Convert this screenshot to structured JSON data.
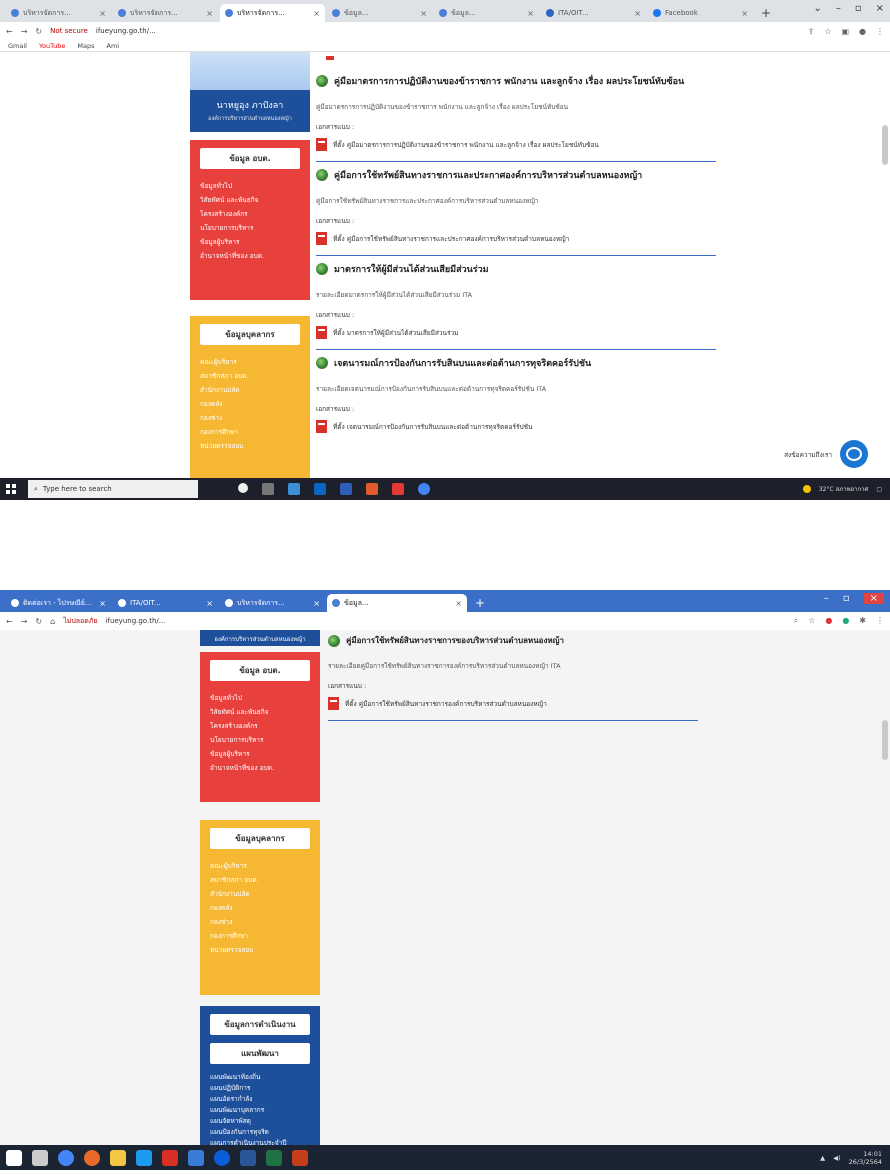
{
  "shot1": {
    "tabs": [
      {
        "label": "บริหารจัดการ..."
      },
      {
        "label": "บริหารจัดการ..."
      },
      {
        "label": "บริหารจัดการ..."
      },
      {
        "label": "ข้อมูล..."
      },
      {
        "label": "ข้อมูล..."
      },
      {
        "label": "ITA/OIT..."
      },
      {
        "label": "Facebook"
      }
    ],
    "url_warning": "Not secure",
    "url": "ifueyung.go.th/...",
    "bookmarks": [
      "Gmail",
      "YouTube",
      "Maps",
      "Ami"
    ],
    "brand_name": "นาหยูอุง ภาปังลา",
    "brand_sub": "องค์การบริหารส่วนตำบลหนองหญ้า",
    "sidebar_red_title": "ข้อมูล อบต.",
    "sidebar_red_links": [
      "ข้อมูลทั่วไป",
      "วิสัยทัศน์ และพันธกิจ",
      "โครงสร้างองค์กร",
      "นโยบายการบริหาร",
      "ข้อมูลผู้บริหาร",
      "อำนาจหน้าที่ของ อบต."
    ],
    "sidebar_yellow_title": "ข้อมูลบุคลากร",
    "sidebar_yellow_links": [
      "คณะผู้บริหาร",
      "สมาชิกสภา อบต.",
      "สำนักงานปลัด",
      "กองคลัง",
      "กองช่าง",
      "กองการศึกษา",
      "หน่วยตรวจสอบ"
    ],
    "sections": [
      {
        "title": "คู่มือมาตรการการปฏิบัติงานของข้าราชการ พนักงาน และลูกจ้าง เรื่อง ผลประโยชน์ทับซ้อน",
        "desc": "คู่มือมาตรการการปฏิบัติงานของข้าราชการ พนักงาน และลูกจ้าง เรื่อง ผลประโยชน์ทับซ้อน",
        "attach_label": "เอกสารแนบ :",
        "file": "ที่ตั้ง คู่มือมาตรการการปฏิบัติงานของข้าราชการ พนักงาน และลูกจ้าง เรื่อง ผลประโยชน์ทับซ้อน"
      },
      {
        "title": "คู่มือการใช้ทรัพย์สินทางราชการและประกาศองค์การบริหารส่วนตำบลหนองหญ้า",
        "desc": "คู่มือการใช้ทรัพย์สินทางราชการและประกาศองค์การบริหารส่วนตำบลหนองหญ้า",
        "attach_label": "เอกสารแนบ :",
        "file": "ที่ตั้ง คู่มือการใช้ทรัพย์สินทางราชการและประกาศองค์การบริหารส่วนตำบลหนองหญ้า"
      },
      {
        "title": "มาตรการให้ผู้มีส่วนได้ส่วนเสียมีส่วนร่วม",
        "desc": "รายละเอียดมาตรการให้ผู้มีส่วนได้ส่วนเสียมีส่วนร่วม ITA",
        "attach_label": "เอกสารแนบ :",
        "file": "ที่ตั้ง มาตรการให้ผู้มีส่วนได้ส่วนเสียมีส่วนร่วม"
      },
      {
        "title": "เจตนารมณ์การป้องกันการรับสินบนและต่อต้านการทุจริตคอร์รัปชัน",
        "desc": "รายละเอียดเจตนารมณ์การป้องกันการรับสินบนและต่อต้านการทุจริตคอร์รัปชัน ITA",
        "attach_label": "เอกสารแนบ :",
        "file": "ที่ตั้ง เจตนารมณ์การป้องกันการรับสินบนและต่อต้านการทุจริตคอร์รัปชัน"
      }
    ],
    "chat_label": "ส่งข้อความถึงเรา",
    "search_placeholder": "Type here to search",
    "tray_text": "32°C สภาพอากาศ"
  },
  "shot2": {
    "tabs": [
      {
        "label": "ติดต่อเรา - ไปรษณีย์..."
      },
      {
        "label": "ITA/OIT..."
      },
      {
        "label": "บริหารจัดการ..."
      },
      {
        "label": "ข้อมูล..."
      }
    ],
    "url_warning": "ไม่ปลอดภัย",
    "url": "ifueyung.go.th/...",
    "section": {
      "title": "คู่มือการใช้ทรัพย์สินทางราชการของบริหารส่วนตำบลหนองหญ้า",
      "desc": "รายละเอียดคู่มือการใช้ทรัพย์สินทางราชการองค์การบริหารส่วนตำบลหนองหญ้า ITA",
      "attach_label": "เอกสารแนบ :",
      "file": "ที่ตั้ง คู่มือการใช้ทรัพย์สินทางราชการองค์การบริหารส่วนตำบลหนองหญ้า"
    },
    "sidebar_top_label": "องค์การบริหารส่วนตำบลหนองหญ้า",
    "sidebar_red_title": "ข้อมูล อบต.",
    "sidebar_red_links": [
      "ข้อมูลทั่วไป",
      "วิสัยทัศน์ และพันธกิจ",
      "โครงสร้างองค์กร",
      "นโยบายการบริหาร",
      "ข้อมูลผู้บริหาร",
      "อำนาจหน้าที่ของ อบต."
    ],
    "sidebar_yellow_title": "ข้อมูลบุคลากร",
    "sidebar_yellow_links": [
      "คณะผู้บริหาร",
      "สมาชิกสภา อบต.",
      "สำนักงานปลัด",
      "กองคลัง",
      "กองช่าง",
      "กองการศึกษา",
      "หน่วยตรวจสอบ"
    ],
    "sidebar_blue_title1": "ข้อมูลการดำเนินงาน",
    "sidebar_blue_title2": "แผนพัฒนา",
    "sidebar_blue_links": [
      "แผนพัฒนาท้องถิ่น",
      "แผนปฏิบัติการ",
      "แผนอัตรากำลัง",
      "แผนพัฒนาบุคลากร",
      "แผนจัดหาพัสดุ",
      "แผนป้องกันการทุจริต",
      "แผนการดำเนินงานประจำปี"
    ],
    "time": "14:01",
    "date": "26/3/2564"
  },
  "colors": {
    "red": "#e8413d",
    "yellow": "#f6b832",
    "blue": "#1e4f9a",
    "rule": "#3a6cc4"
  }
}
